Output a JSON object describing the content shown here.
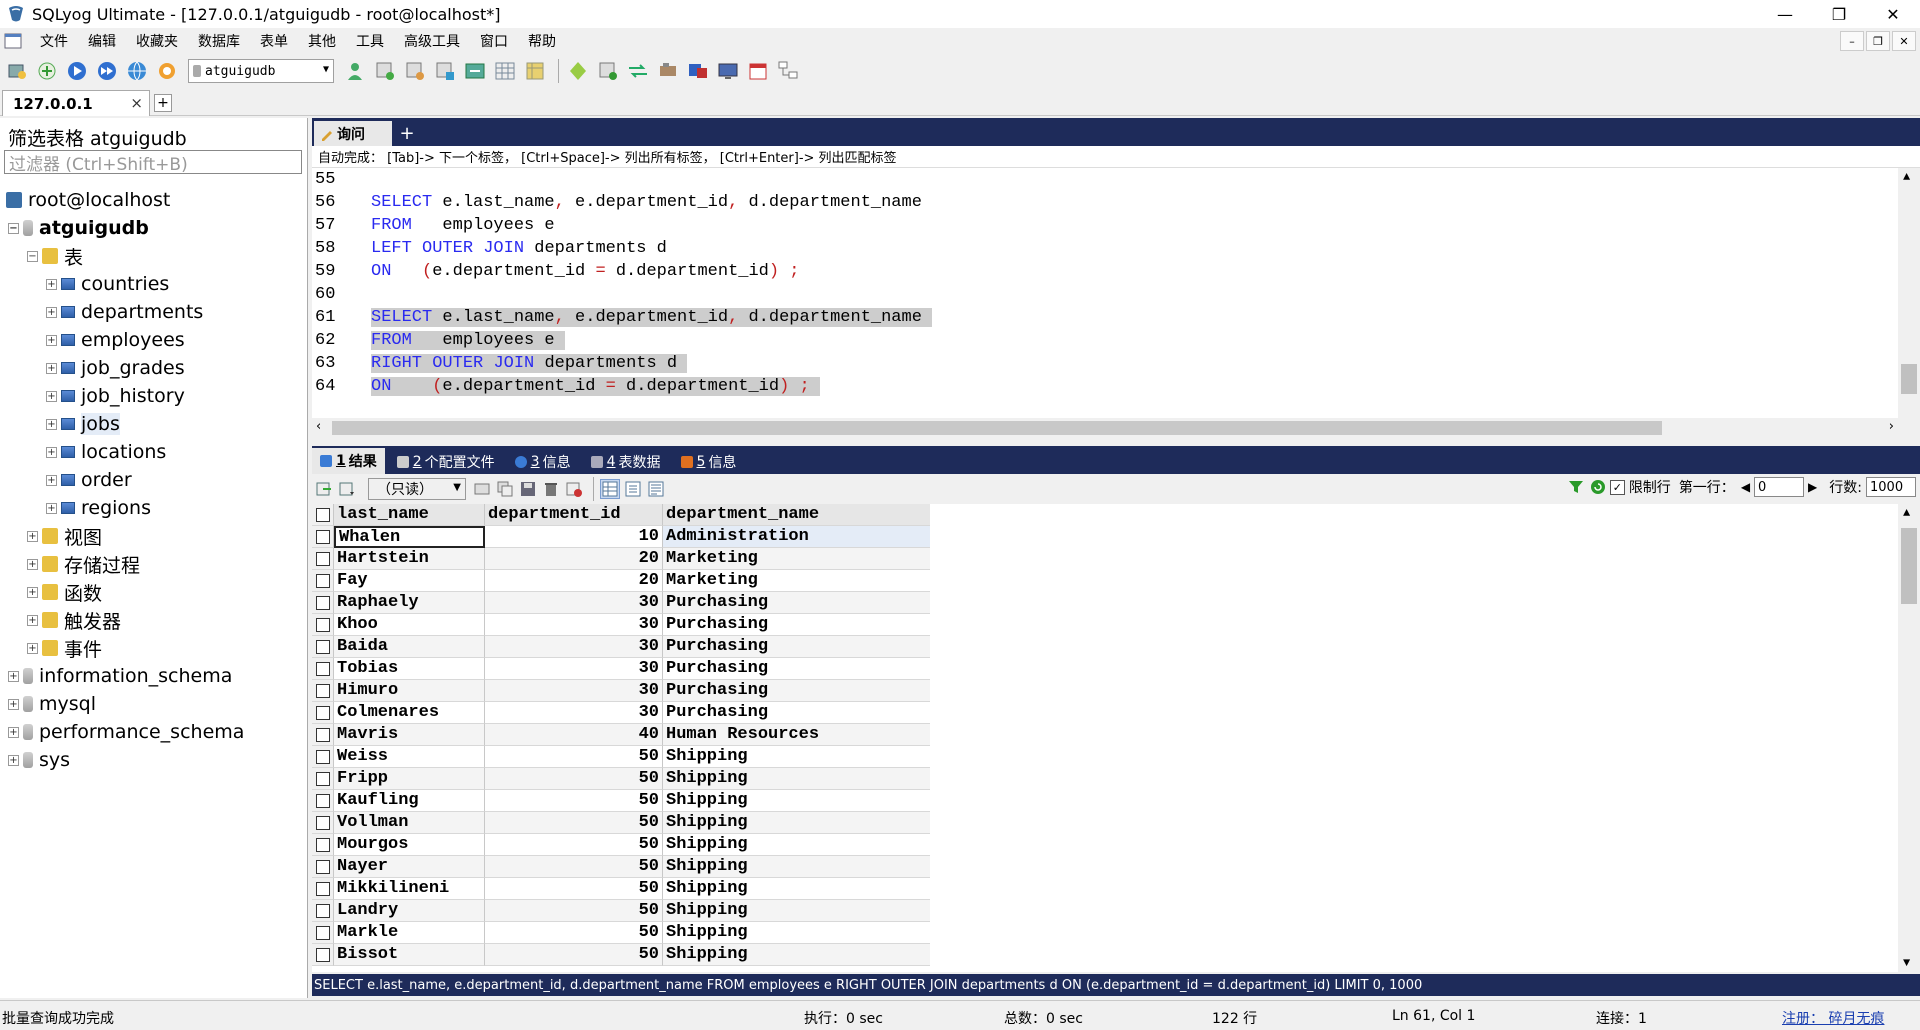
{
  "window": {
    "title": "SQLyog Ultimate - [127.0.0.1/atguigudb - root@localhost*]",
    "controls": [
      "—",
      "❐",
      "✕"
    ]
  },
  "menu": [
    "文件",
    "编辑",
    "收藏夹",
    "数据库",
    "表单",
    "其他",
    "工具",
    "高级工具",
    "窗口",
    "帮助"
  ],
  "toolbar": {
    "database_select": "atguigudb"
  },
  "connection_tab": {
    "label": "127.0.0.1",
    "close": "×",
    "add": "+"
  },
  "object_browser": {
    "filter_label": "筛选表格 atguigudb",
    "filter_placeholder": "过滤器 (Ctrl+Shift+B)",
    "server": "root@localhost",
    "database": "atguigudb",
    "tables_folder": "表",
    "tables": [
      "countries",
      "departments",
      "employees",
      "job_grades",
      "job_history",
      "jobs",
      "locations",
      "order",
      "regions"
    ],
    "selected_table": "jobs",
    "folders": [
      "视图",
      "存储过程",
      "函数",
      "触发器",
      "事件"
    ],
    "other_databases": [
      "information_schema",
      "mysql",
      "performance_schema",
      "sys"
    ]
  },
  "query_tab": {
    "label": "询问",
    "add": "+"
  },
  "autocomplete_hint": "自动完成： [Tab]-> 下一个标签， [Ctrl+Space]-> 列出所有标签， [Ctrl+Enter]-> 列出匹配标签",
  "editor": {
    "line_numbers": [
      "55",
      "56",
      "57",
      "58",
      "59",
      "60",
      "61",
      "62",
      "63",
      "64"
    ]
  },
  "result_tabs": [
    {
      "num": "1",
      "label": "结果",
      "color": "#3a7bd5"
    },
    {
      "num": "2",
      "label": "个配置文件",
      "color": "#888888"
    },
    {
      "num": "3",
      "label": "信息",
      "color": "#3a7bd5"
    },
    {
      "num": "4",
      "label": "表数据",
      "color": "#5a5a8a"
    },
    {
      "num": "5",
      "label": "信息",
      "color": "#e07020"
    }
  ],
  "results_toolbar": {
    "readonly": "（只读）",
    "limit_label": "限制行",
    "first_row_label": "第一行：",
    "first_row_value": "0",
    "rows_label": "行数:",
    "rows_value": "1000"
  },
  "grid": {
    "columns": [
      "last_name",
      "department_id",
      "department_name"
    ],
    "rows": [
      [
        "Whalen",
        "10",
        "Administration"
      ],
      [
        "Hartstein",
        "20",
        "Marketing"
      ],
      [
        "Fay",
        "20",
        "Marketing"
      ],
      [
        "Raphaely",
        "30",
        "Purchasing"
      ],
      [
        "Khoo",
        "30",
        "Purchasing"
      ],
      [
        "Baida",
        "30",
        "Purchasing"
      ],
      [
        "Tobias",
        "30",
        "Purchasing"
      ],
      [
        "Himuro",
        "30",
        "Purchasing"
      ],
      [
        "Colmenares",
        "30",
        "Purchasing"
      ],
      [
        "Mavris",
        "40",
        "Human Resources"
      ],
      [
        "Weiss",
        "50",
        "Shipping"
      ],
      [
        "Fripp",
        "50",
        "Shipping"
      ],
      [
        "Kaufling",
        "50",
        "Shipping"
      ],
      [
        "Vollman",
        "50",
        "Shipping"
      ],
      [
        "Mourgos",
        "50",
        "Shipping"
      ],
      [
        "Nayer",
        "50",
        "Shipping"
      ],
      [
        "Mikkilineni",
        "50",
        "Shipping"
      ],
      [
        "Landry",
        "50",
        "Shipping"
      ],
      [
        "Markle",
        "50",
        "Shipping"
      ],
      [
        "Bissot",
        "50",
        "Shipping"
      ]
    ]
  },
  "sql_info": "SELECT e.last_name, e.department_id, d.department_name FROM employees e RIGHT OUTER JOIN departments d ON (e.department_id = d.department_id) LIMIT 0, 1000",
  "status": {
    "message": "批量查询成功完成",
    "exec": "执行：0 sec",
    "total": "总数：0 sec",
    "rows": "122 行",
    "position": "Ln 61, Col 1",
    "connections": "连接：1",
    "register": "注册： 碎月无痕"
  },
  "colors": {
    "keyword": "#2a2af0",
    "tab_strip": "#1e2b5a",
    "selection": "#cdcdcd"
  }
}
